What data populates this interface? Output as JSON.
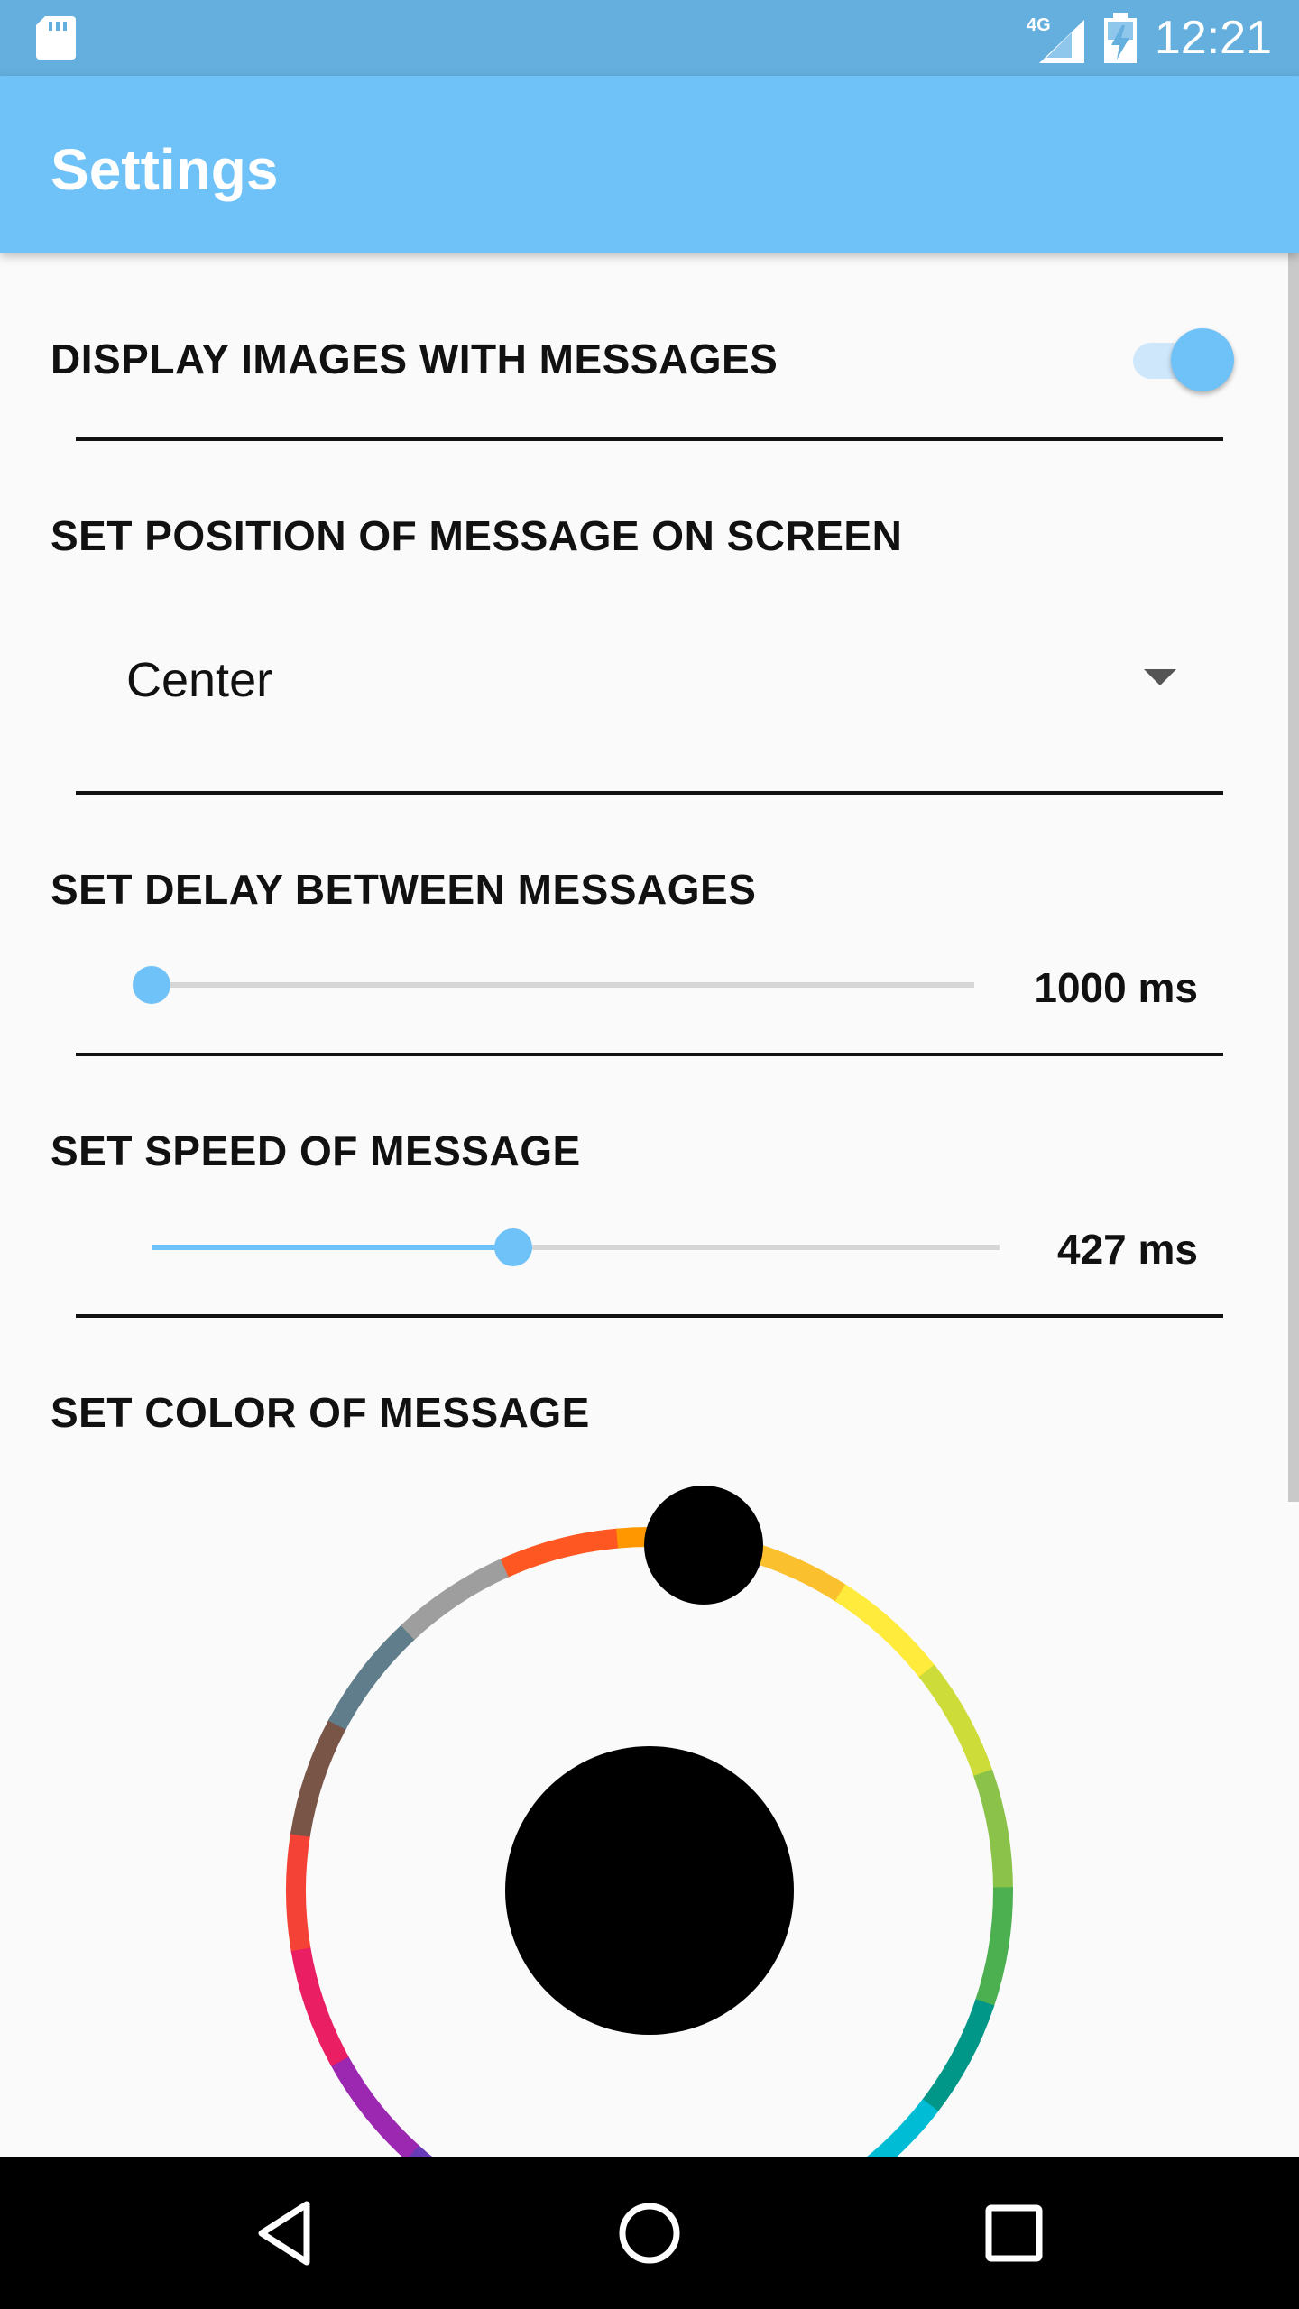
{
  "status_bar": {
    "time": "12:21",
    "network": "4G",
    "icons": [
      "sd-card-icon",
      "signal-icon",
      "battery-charging-icon"
    ]
  },
  "app_bar": {
    "title": "Settings",
    "color": "#6ec2f7"
  },
  "settings": {
    "display_images": {
      "label": "DISPLAY IMAGES WITH MESSAGES",
      "enabled": true
    },
    "position": {
      "label": "SET POSITION OF MESSAGE ON SCREEN",
      "selected": "Center"
    },
    "delay": {
      "label": "SET DELAY BETWEEN MESSAGES",
      "value_text": "1000 ms",
      "fraction": 0.0
    },
    "speed": {
      "label": "SET SPEED OF MESSAGE",
      "value_text": "427 ms",
      "fraction": 0.427
    },
    "color": {
      "label": "SET COLOR OF MESSAGE",
      "selected_color": "#000000",
      "palette": [
        "#f44336",
        "#795548",
        "#607d8b",
        "#9e9e9e",
        "#ff5722",
        "#ff9800",
        "#fbc02d",
        "#ffeb3b",
        "#cddc39",
        "#8bc34a",
        "#4caf50",
        "#009688",
        "#00bcd4",
        "#03a9f4",
        "#2196f3",
        "#3f51b5",
        "#673ab7",
        "#9c27b0",
        "#e91e63"
      ]
    }
  },
  "nav_bar": {
    "buttons": [
      "back-icon",
      "home-icon",
      "recents-icon"
    ]
  }
}
